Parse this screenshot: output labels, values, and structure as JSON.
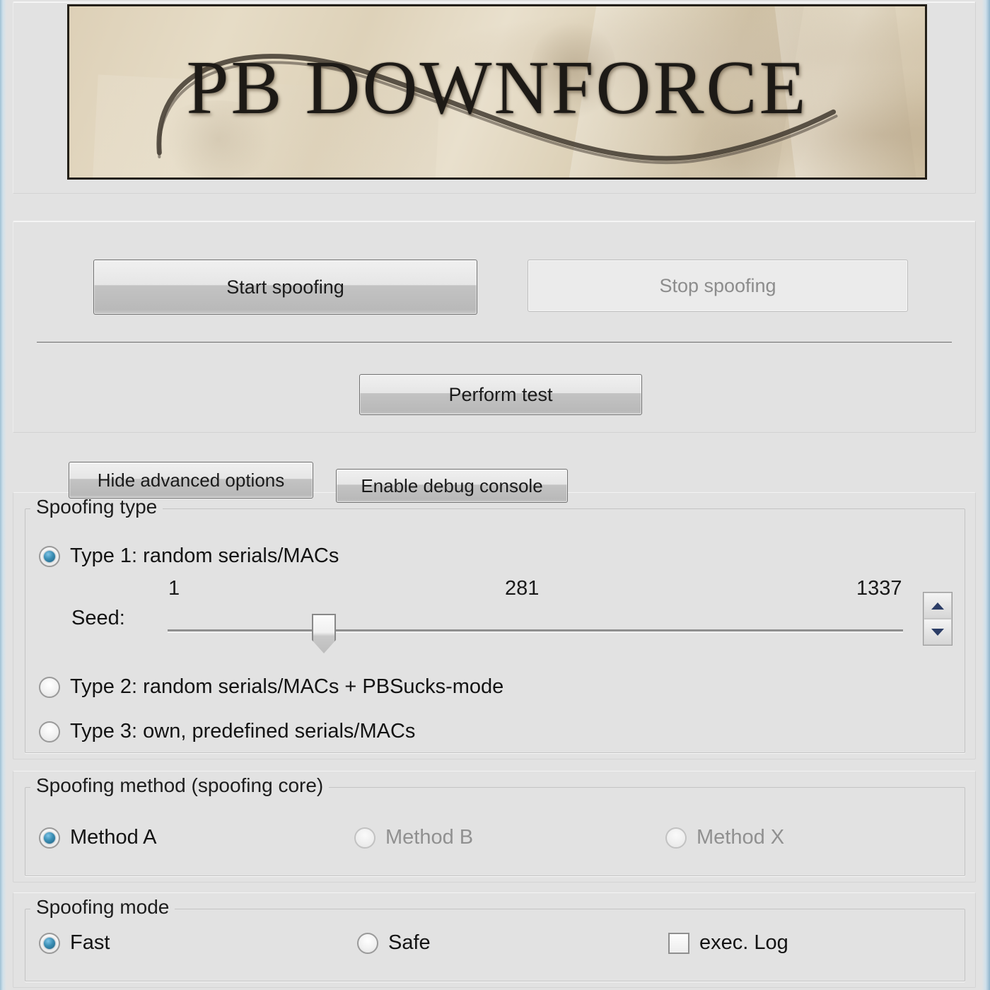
{
  "app": {
    "banner_title": "PB DOWNFORCE"
  },
  "actions": {
    "start_label": "Start spoofing",
    "stop_label": "Stop spoofing",
    "test_label": "Perform test",
    "hide_advanced_label": "Hide advanced options",
    "debug_console_label": "Enable debug console"
  },
  "spoofing_type": {
    "group_label": "Spoofing type",
    "options": [
      {
        "label": "Type 1: random serials/MACs",
        "checked": true,
        "enabled": true
      },
      {
        "label": "Type 2: random serials/MACs + PBSucks-mode",
        "checked": false,
        "enabled": true
      },
      {
        "label": "Type 3: own, predefined serials/MACs",
        "checked": false,
        "enabled": true
      }
    ],
    "seed": {
      "label": "Seed:",
      "min": "1",
      "value": "281",
      "max": "1337"
    }
  },
  "spoofing_method": {
    "group_label": "Spoofing method (spoofing core)",
    "options": [
      {
        "label": "Method A",
        "checked": true,
        "enabled": true
      },
      {
        "label": "Method B",
        "checked": false,
        "enabled": false
      },
      {
        "label": "Method X",
        "checked": false,
        "enabled": false
      }
    ]
  },
  "spoofing_mode": {
    "group_label": "Spoofing mode",
    "options": [
      {
        "label": "Fast",
        "checked": true,
        "enabled": true
      },
      {
        "label": "Safe",
        "checked": false,
        "enabled": true
      }
    ],
    "exec_log_label": "exec. Log",
    "exec_log_checked": false
  },
  "colors": {
    "window_background": "#e2e2e2",
    "frame_blue": "#9fc0d4",
    "radio_accent": "#3b8fb5",
    "banner_paper": "#ded2b9",
    "banner_ink": "#1d1a16",
    "spinner_arrow": "#2b3d66"
  }
}
